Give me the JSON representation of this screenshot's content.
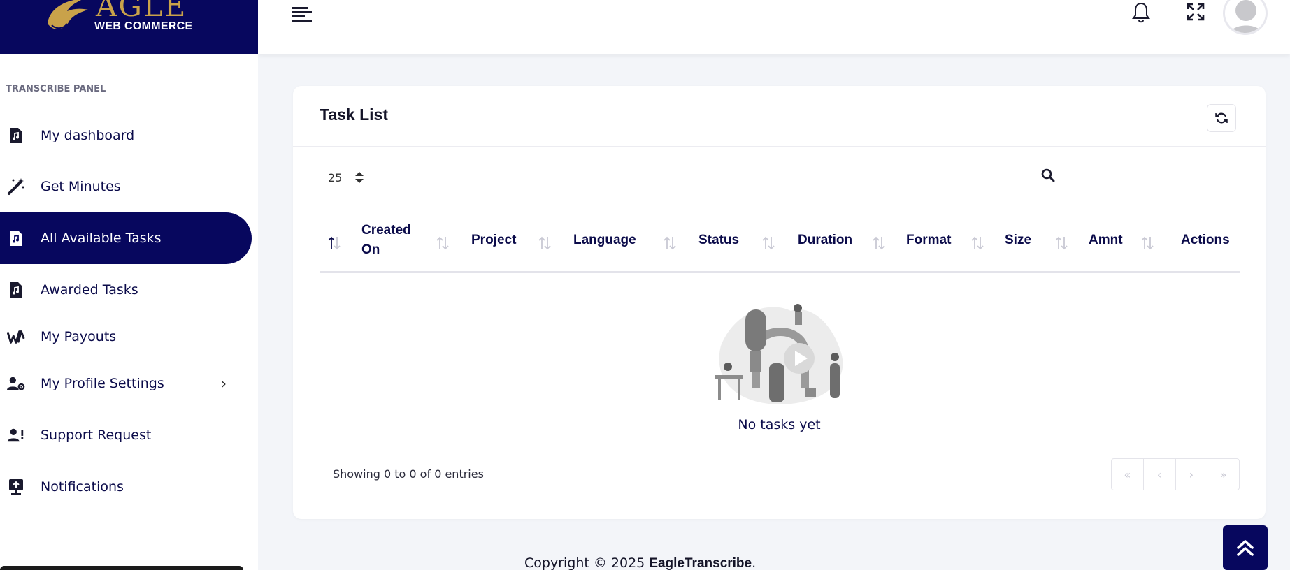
{
  "brand": {
    "logo_text": "AGLE",
    "logo_subtext": "WEB COMMERCE"
  },
  "sidebar": {
    "panel_label": "TRANSCRIBE PANEL",
    "items": [
      {
        "label": "My dashboard",
        "icon": "music-file-icon"
      },
      {
        "label": "Get Minutes",
        "icon": "magic-wand-icon"
      },
      {
        "label": "All Available Tasks",
        "icon": "music-file-icon",
        "active": true
      },
      {
        "label": "Awarded Tasks",
        "icon": "music-file-icon"
      },
      {
        "label": "My Payouts",
        "icon": "wallet-logo-icon"
      },
      {
        "label": "My Profile Settings",
        "icon": "user-gear-icon",
        "has_submenu": true
      },
      {
        "label": "Support Request",
        "icon": "user-alert-icon"
      },
      {
        "label": "Notifications",
        "icon": "notification-upload-icon"
      }
    ]
  },
  "header": {
    "icons": [
      "menu-icon",
      "bell-icon",
      "expand-icon",
      "avatar"
    ]
  },
  "task_list": {
    "title": "Task List",
    "page_length": "25",
    "search_value": "",
    "columns": [
      "",
      "Created On",
      "Project",
      "Language",
      "Status",
      "Duration",
      "Format",
      "Size",
      "Amnt",
      "Actions"
    ],
    "rows": [],
    "empty_message": "No tasks yet",
    "info": "Showing 0 to 0 of 0 entries",
    "pager": [
      "«",
      "‹",
      "›",
      "»"
    ]
  },
  "footer": {
    "copyright": "Copyright © 2025 ",
    "brand": "EagleTranscribe",
    "suffix": "."
  },
  "colors": {
    "primary": "#07075e",
    "gold": "#c9a24a",
    "background": "#f3f5f9"
  }
}
